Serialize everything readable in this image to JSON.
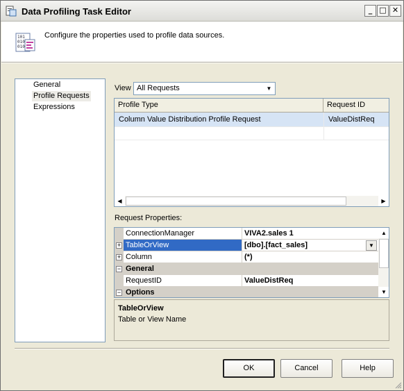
{
  "window": {
    "title": "Data Profiling Task Editor"
  },
  "header": {
    "description": "Configure the properties used to profile data sources."
  },
  "nav": {
    "items": [
      "General",
      "Profile Requests",
      "Expressions"
    ],
    "selected": "Profile Requests"
  },
  "view": {
    "label": "View",
    "selected": "All Requests"
  },
  "requests": {
    "columns": [
      "Profile Type",
      "Request ID"
    ],
    "rows": [
      [
        "Column Value Distribution Profile Request",
        "ValueDistReq"
      ]
    ]
  },
  "properties": {
    "label": "Request Properties:",
    "rows": [
      {
        "name": "ConnectionManager",
        "value": "VIVA2.sales 1"
      },
      {
        "name": "TableOrView",
        "value": "[dbo].[fact_sales]"
      },
      {
        "name": "Column",
        "value": "(*)"
      },
      {
        "category": "General"
      },
      {
        "name": "RequestID",
        "value": "ValueDistReq"
      },
      {
        "category": "Options"
      }
    ]
  },
  "description": {
    "title": "TableOrView",
    "text": "Table or View Name"
  },
  "buttons": {
    "ok": "OK",
    "cancel": "Cancel",
    "help": "Help"
  },
  "colors": {
    "selection": "#316ac5",
    "row_selected": "#d6e4f5",
    "dialog_bg": "#ece9d8"
  },
  "icons": [
    "app-icon",
    "minimize-icon",
    "maximize-icon",
    "close-icon",
    "profile-doc-icon",
    "expand-plus-icon",
    "collapse-minus-icon",
    "dropdown-arrow-icon"
  ]
}
